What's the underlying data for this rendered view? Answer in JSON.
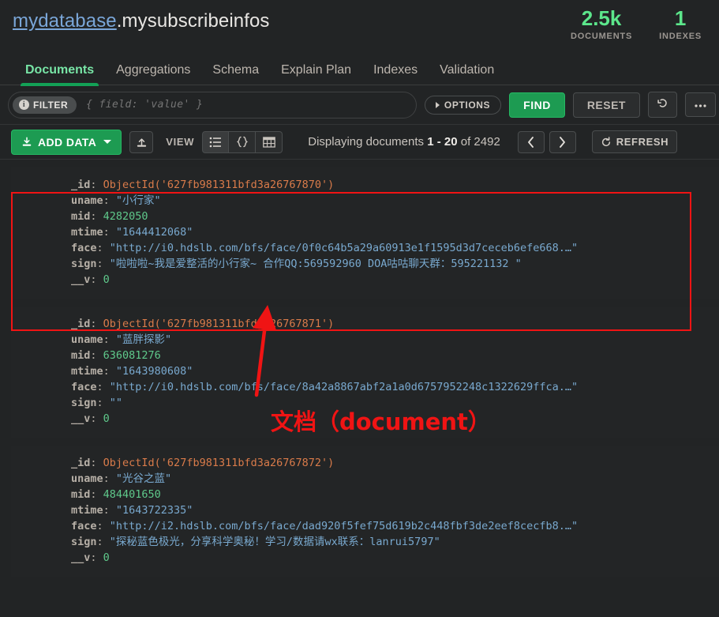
{
  "header": {
    "database": "mydatabase",
    "separator": ".",
    "collection": "mysubscribeinfos",
    "stats": [
      {
        "value": "2.5k",
        "label": "DOCUMENTS"
      },
      {
        "value": "1",
        "label": "INDEXES"
      }
    ]
  },
  "tabs": [
    {
      "label": "Documents",
      "active": true
    },
    {
      "label": "Aggregations",
      "active": false
    },
    {
      "label": "Schema",
      "active": false
    },
    {
      "label": "Explain Plan",
      "active": false
    },
    {
      "label": "Indexes",
      "active": false
    },
    {
      "label": "Validation",
      "active": false
    }
  ],
  "querybar": {
    "filter_label": "FILTER",
    "filter_info_icon": "info-circle-icon",
    "filter_value": "",
    "filter_placeholder": "{ field: 'value' }",
    "options_label": "OPTIONS",
    "options_caret_icon": "caret-right-icon",
    "find_label": "FIND",
    "reset_label": "RESET",
    "history_icon": "history-revert-icon",
    "more_icon": "ellipsis-icon"
  },
  "toolbar": {
    "add_data_label": "ADD DATA",
    "add_data_icon": "download-icon",
    "add_data_caret_icon": "caret-down-icon",
    "export_icon": "upload-export-icon",
    "view_label": "VIEW",
    "view_modes": [
      {
        "name": "list-view",
        "icon": "list-icon",
        "selected": true
      },
      {
        "name": "json-view",
        "icon": "braces-icon",
        "selected": false
      },
      {
        "name": "table-view",
        "icon": "table-grid-icon",
        "selected": false
      }
    ],
    "displaying_prefix": "Displaying documents",
    "range_start": "1",
    "range_dash": "-",
    "range_end": "20",
    "of_word": "of",
    "total": "2492",
    "prev_icon": "chevron-left-icon",
    "next_icon": "chevron-right-icon",
    "refresh_label": "REFRESH",
    "refresh_icon": "refresh-icon"
  },
  "documents": [
    {
      "highlighted": true,
      "fields": [
        {
          "key": "_id",
          "type": "oid",
          "value": "ObjectId('627fb981311bfd3a26767870')"
        },
        {
          "key": "uname",
          "type": "str",
          "value": "\"小行家\""
        },
        {
          "key": "mid",
          "type": "num",
          "value": "4282050"
        },
        {
          "key": "mtime",
          "type": "str",
          "value": "\"1644412068\""
        },
        {
          "key": "face",
          "type": "str",
          "value": "\"http://i0.hdslb.com/bfs/face/0f0c64b5a29a60913e1f1595d3d7ceceb6efe668.…\""
        },
        {
          "key": "sign",
          "type": "str",
          "value": "\"啦啦啦~我是爱整活的小行家~ 合作QQ:569592960  DOA咕咕聊天群：595221132  \""
        },
        {
          "key": "__v",
          "type": "num",
          "value": "0"
        }
      ]
    },
    {
      "highlighted": false,
      "fields": [
        {
          "key": "_id",
          "type": "oid",
          "value": "ObjectId('627fb981311bfd3a26767871')"
        },
        {
          "key": "uname",
          "type": "str",
          "value": "\"蓝胖探影\""
        },
        {
          "key": "mid",
          "type": "num",
          "value": "636081276"
        },
        {
          "key": "mtime",
          "type": "str",
          "value": "\"1643980608\""
        },
        {
          "key": "face",
          "type": "str",
          "value": "\"http://i0.hdslb.com/bfs/face/8a42a8867abf2a1a0d6757952248c1322629ffca.…\""
        },
        {
          "key": "sign",
          "type": "str",
          "value": "\"\""
        },
        {
          "key": "__v",
          "type": "num",
          "value": "0"
        }
      ]
    },
    {
      "highlighted": false,
      "fields": [
        {
          "key": "_id",
          "type": "oid",
          "value": "ObjectId('627fb981311bfd3a26767872')"
        },
        {
          "key": "uname",
          "type": "str",
          "value": "\"光谷之蓝\""
        },
        {
          "key": "mid",
          "type": "num",
          "value": "484401650"
        },
        {
          "key": "mtime",
          "type": "str",
          "value": "\"1643722335\""
        },
        {
          "key": "face",
          "type": "str",
          "value": "\"http://i2.hdslb.com/bfs/face/dad920f5fef75d619b2c448fbf3de2eef8cecfb8.…\""
        },
        {
          "key": "sign",
          "type": "str",
          "value": "\"探秘蓝色极光，分享科学奥秘！学习/数据请wx联系：lanrui5797\""
        },
        {
          "key": "__v",
          "type": "num",
          "value": "0"
        }
      ]
    }
  ],
  "annotation": {
    "text": "文档（document）",
    "color": "#f01414",
    "box_name": "document-highlight-box",
    "arrow_name": "annotation-arrow"
  },
  "colors": {
    "accent_green": "#13a156",
    "stat_green": "#5ce68b",
    "link_blue": "#7aa6d8",
    "annotation_red": "#f01414",
    "page_bg": "#222425",
    "card_bg": "#232526"
  }
}
